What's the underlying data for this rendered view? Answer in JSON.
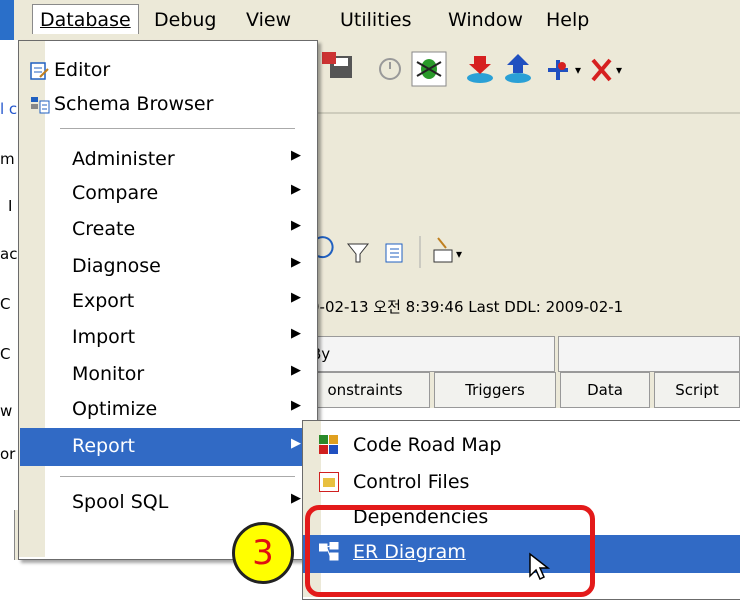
{
  "menubar": {
    "items": [
      {
        "label": "Database",
        "mnemonic_index": 0
      },
      {
        "label": "Debug"
      },
      {
        "label": "View"
      },
      {
        "label": "Utilities"
      },
      {
        "label": "Window"
      },
      {
        "label": "Help"
      }
    ]
  },
  "database_menu": {
    "items": [
      {
        "label": "Editor",
        "icon": "editor-icon"
      },
      {
        "label": "Schema Browser",
        "icon": "schema-browser-icon"
      },
      {
        "label": "Administer",
        "submenu": true
      },
      {
        "label": "Compare",
        "submenu": true
      },
      {
        "label": "Create",
        "submenu": true
      },
      {
        "label": "Diagnose",
        "submenu": true
      },
      {
        "label": "Export",
        "submenu": true
      },
      {
        "label": "Import",
        "submenu": true
      },
      {
        "label": "Monitor",
        "submenu": true
      },
      {
        "label": "Optimize",
        "submenu": true
      },
      {
        "label": "Report",
        "submenu": true,
        "highlighted": true
      },
      {
        "label": "Spool SQL",
        "submenu": true
      }
    ]
  },
  "report_menu": {
    "items": [
      {
        "label": "Code Road Map",
        "icon": "code-road-map-icon"
      },
      {
        "label": "Control Files",
        "icon": "control-files-icon"
      },
      {
        "label": "Dependencies",
        "icon": "dependencies-icon"
      },
      {
        "label": "ER Diagram",
        "icon": "er-diagram-icon",
        "highlighted": true
      }
    ]
  },
  "background": {
    "left_fragments": [
      "l c",
      "m",
      "I",
      "ac",
      "C",
      "C",
      "w",
      "or"
    ],
    "info_text": "9-02-13 오전 8:39:46   Last DDL: 2009-02-1",
    "grid_header": "By",
    "tabs": [
      "onstraints",
      "Triggers",
      "Data",
      "Script"
    ]
  },
  "annotation": {
    "step_number": "3",
    "badge_color": "#ffff00",
    "box_color": "#e31a1a"
  },
  "colors": {
    "menu_highlight": "#316ac5",
    "window_face": "#ece9d8",
    "title_band": "#2a6fc9"
  }
}
